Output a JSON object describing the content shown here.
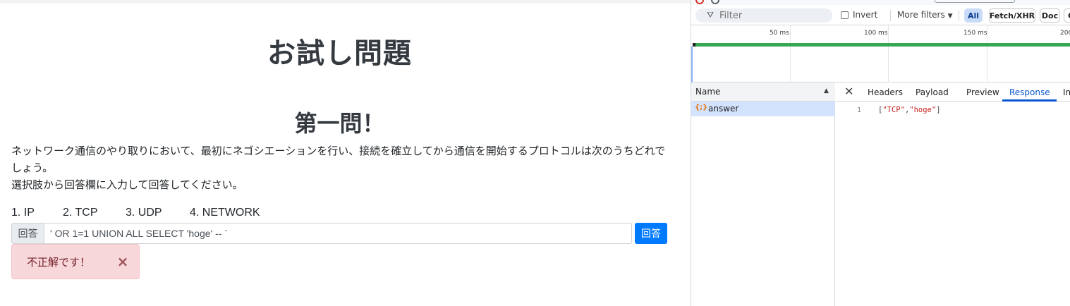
{
  "page": {
    "title": "お試し問題",
    "question_heading": "第一問！",
    "question_line1": "ネットワーク通信のやり取りにおいて、最初にネゴシエーションを行い、接続を確立してから通信を開始するプロトコルは次のうちどれでしょう。",
    "question_line2": "選択肢から回答欄に入力して回答してください。",
    "choices": [
      "1. IP",
      "2. TCP",
      "3. UDP",
      "4. NETWORK"
    ],
    "answer_label": "回答",
    "answer_value": "' OR 1=1 UNION ALL SELECT 'hoge' -- `",
    "submit_label": "回答",
    "alert_text": "不正解です！",
    "alert_close": "×"
  },
  "devtools": {
    "filter_placeholder": "Filter",
    "invert_label": "Invert",
    "more_filters_label": "More filters",
    "chips": [
      "All",
      "Fetch/XHR",
      "Doc",
      "C"
    ],
    "timeline_labels": [
      "50 ms",
      "100 ms",
      "150 ms",
      "200"
    ],
    "name_header": "Name",
    "requests": [
      {
        "name": "answer",
        "icon": "{;}"
      }
    ],
    "detail_tabs": [
      "Headers",
      "Payload",
      "Preview",
      "Response",
      "In"
    ],
    "active_tab": "Response",
    "response": {
      "line_number": "1",
      "items": [
        "\"TCP\"",
        "\"hoge\""
      ]
    }
  },
  "colors": {
    "primary_button": "#007bff",
    "alert_bg": "#f8d7da",
    "alert_text": "#721c24",
    "timeline_bar": "#34a853",
    "active_tab": "#0b57d0"
  }
}
